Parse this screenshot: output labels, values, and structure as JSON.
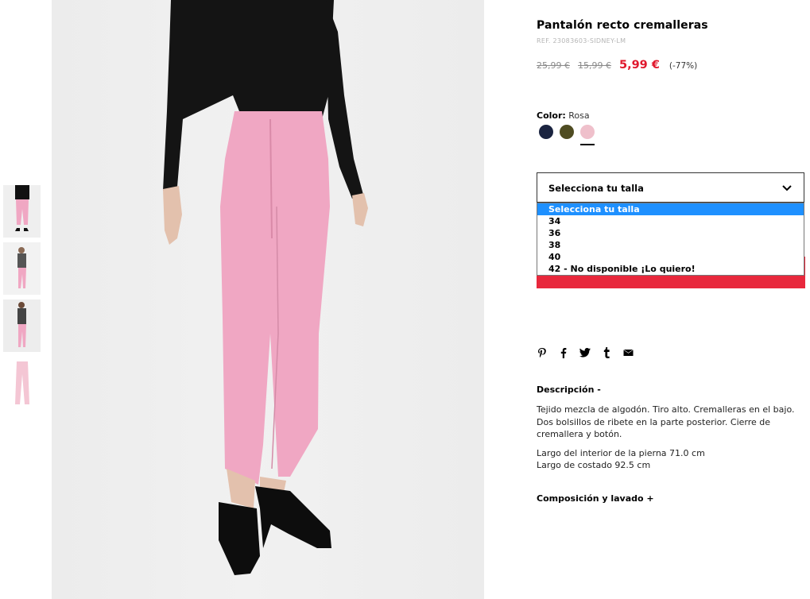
{
  "product": {
    "title": "Pantalón recto cremalleras",
    "ref": "REF. 23083603-SIDNEY-LM",
    "price_original": "25,99 €",
    "price_previous": "15,99 €",
    "price_current": "5,99 €",
    "discount": "(-77%)"
  },
  "color": {
    "label": "Color:",
    "selected": "Rosa",
    "swatches": [
      {
        "name": "navy",
        "hex": "#1b2440"
      },
      {
        "name": "khaki",
        "hex": "#4f4c22"
      },
      {
        "name": "pink",
        "hex": "#efc0cb"
      }
    ]
  },
  "size": {
    "placeholder": "Selecciona tu talla",
    "options": [
      "Selecciona tu talla",
      "34",
      "36",
      "38",
      "40",
      "42 - No disponible ¡Lo quiero!"
    ]
  },
  "share": {
    "icons": [
      "pinterest-icon",
      "facebook-icon",
      "twitter-icon",
      "tumblr-icon",
      "email-icon"
    ]
  },
  "description": {
    "heading": "Descripción -",
    "paragraph1": "Tejido mezcla de algodón. Tiro alto. Cremalleras en el bajo. Dos bolsillos de ribete en la parte posterior. Cierre de cremallera y botón.",
    "measure1": "Largo del interior de la pierna 71.0 cm",
    "measure2": "Largo de costado 92.5 cm"
  },
  "composition": {
    "heading": "Composición y lavado +"
  },
  "colors": {
    "sale_red": "#e0182d",
    "add_bar": "#e8283c",
    "highlight": "#1e90ff",
    "pant_pink": "#f0a7c3"
  }
}
